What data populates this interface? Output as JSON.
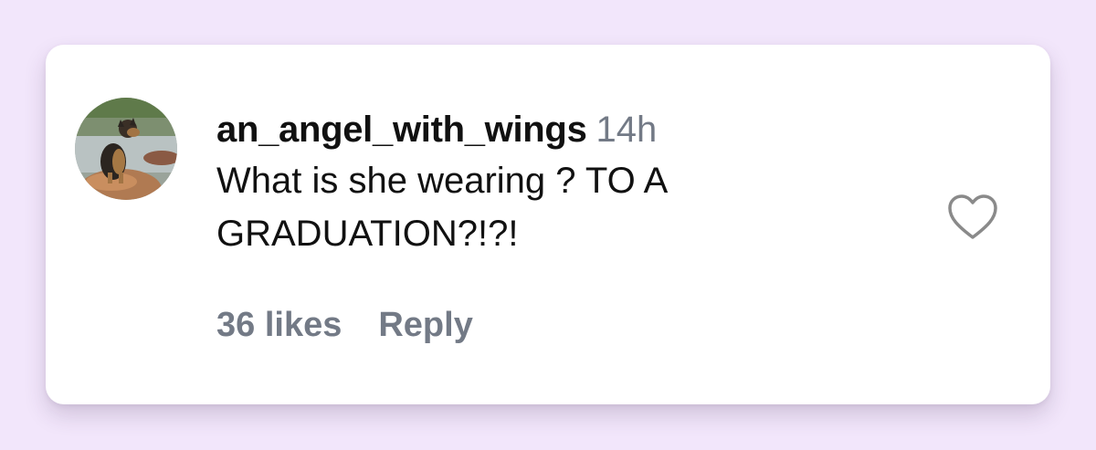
{
  "comment": {
    "username": "an_angel_with_wings",
    "timestamp": "14h",
    "text": "What is she wearing ? TO A GRADUATION?!?!",
    "likes_label": "36 likes",
    "reply_label": "Reply",
    "liked": false
  },
  "icons": {
    "like": "heart-outline-icon",
    "avatar": "user-avatar"
  },
  "colors": {
    "background": "#f2e6fb",
    "card": "#ffffff",
    "primary_text": "#111111",
    "secondary_text": "#737a86",
    "heart_outline": "#8a8a8a"
  }
}
